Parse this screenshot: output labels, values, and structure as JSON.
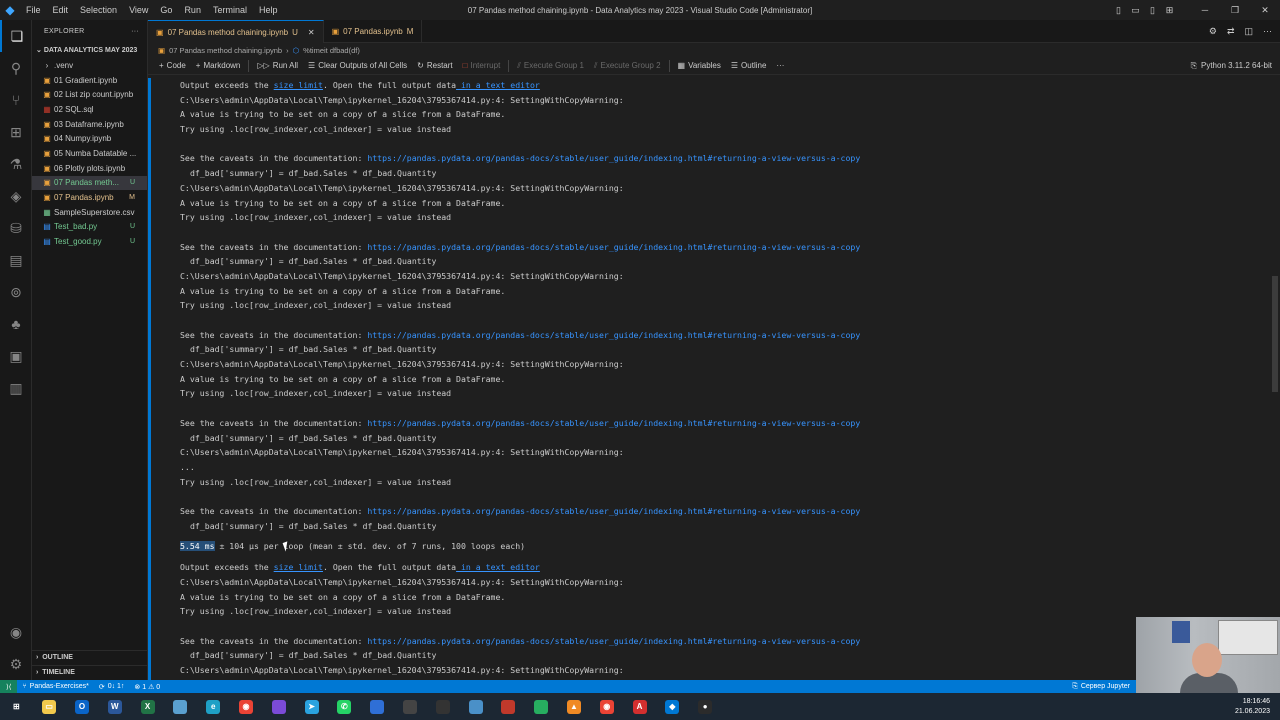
{
  "titlebar": {
    "menu": [
      "File",
      "Edit",
      "Selection",
      "View",
      "Go",
      "Run",
      "Terminal",
      "Help"
    ],
    "window_title": "07 Pandas method chaining.ipynb - Data Analytics may 2023 - Visual Studio Code [Administrator]"
  },
  "sidebar": {
    "header": "EXPLORER",
    "folder": "DATA ANALYTICS MAY 2023",
    "files": [
      {
        "name": ".venv",
        "status": "",
        "kind": "folder"
      },
      {
        "name": "01 Gradient.ipynb",
        "status": "",
        "kind": "nb"
      },
      {
        "name": "02 List zip count.ipynb",
        "status": "",
        "kind": "nb"
      },
      {
        "name": "02 SQL.sql",
        "status": "",
        "kind": "sql"
      },
      {
        "name": "03 Dataframe.ipynb",
        "status": "",
        "kind": "nb"
      },
      {
        "name": "04 Numpy.ipynb",
        "status": "",
        "kind": "nb"
      },
      {
        "name": "05 Numba Datatable ...",
        "status": "",
        "kind": "nb"
      },
      {
        "name": "06 Plotly plots.ipynb",
        "status": "",
        "kind": "nb"
      },
      {
        "name": "07 Pandas meth...",
        "status": "U",
        "kind": "nb"
      },
      {
        "name": "07 Pandas.ipynb",
        "status": "M",
        "kind": "nb"
      },
      {
        "name": "SampleSuperstore.csv",
        "status": "",
        "kind": "csv"
      },
      {
        "name": "Test_bad.py",
        "status": "U",
        "kind": "py"
      },
      {
        "name": "Test_good.py",
        "status": "U",
        "kind": "py"
      }
    ],
    "outline": "OUTLINE",
    "timeline": "TIMELINE"
  },
  "tabs": [
    {
      "label": "07 Pandas method chaining.ipynb",
      "status": "U"
    },
    {
      "label": "07 Pandas.ipynb",
      "status": "M"
    }
  ],
  "breadcrumb": {
    "file": "07 Pandas method chaining.ipynb",
    "cell": "%timeit dfbad(df)"
  },
  "toolbar": {
    "code": "Code",
    "markdown": "Markdown",
    "run_all": "Run All",
    "clear": "Clear Outputs of All Cells",
    "restart": "Restart",
    "interrupt": "Interrupt",
    "group1": "Execute Group 1",
    "group2": "Execute Group 2",
    "variables": "Variables",
    "outline": "Outline",
    "kernel": "Python 3.11.2 64-bit"
  },
  "output": {
    "exceeds_pre": "Output exceeds the ",
    "size_limit": "size limit",
    "exceeds_mid": ". Open the full output data",
    "text_editor": " in a text editor",
    "warn_path": "C:\\Users\\admin\\AppData\\Local\\Temp\\ipykernel_16204\\3795367414.py:4: SettingWithCopyWarning:",
    "warn_value": "A value is trying to be set on a copy of a slice from a DataFrame.",
    "warn_try": "Try using .loc[row_indexer,col_indexer] = value instead",
    "caveats": "See the caveats in the documentation: ",
    "doc_url": "https://pandas.pydata.org/pandas-docs/stable/user_guide/indexing.html#returning-a-view-versus-a-copy",
    "code_line": "df_bad['summary'] = df_bad.Sales * df_bad.Quantity",
    "ellipsis": "...",
    "timing_sel": "5.54 ms",
    "timing_rest": " ± 104 µs per loop (mean ± std. dev. of 7 runs, 100 loops each)"
  },
  "statusbar": {
    "remote": "Pandas-Exercises*",
    "sync": "0↓ 1↑",
    "problems": "⊗ 1 ⚠ 0",
    "jupyter": "Сервер Jupyter"
  },
  "taskbar": {
    "time": "18:16:46",
    "date": "21.06.2023",
    "apps": [
      {
        "name": "windows-start",
        "color": "#ffffff"
      },
      {
        "name": "file-explorer",
        "color": "#f2c94c"
      },
      {
        "name": "outlook",
        "color": "#0a64c8"
      },
      {
        "name": "word",
        "color": "#2b579a"
      },
      {
        "name": "excel",
        "color": "#217346"
      },
      {
        "name": "notepad",
        "color": "#5aa0d0"
      },
      {
        "name": "edge",
        "color": "#1fa0c6"
      },
      {
        "name": "chrome",
        "color": "#ea4335"
      },
      {
        "name": "app-purple",
        "color": "#7b4bd8"
      },
      {
        "name": "telegram",
        "color": "#2aa3e0"
      },
      {
        "name": "whatsapp",
        "color": "#25d366"
      },
      {
        "name": "app-blue",
        "color": "#2f6fd6"
      },
      {
        "name": "app-dark",
        "color": "#444444"
      },
      {
        "name": "app-terminal",
        "color": "#333333"
      },
      {
        "name": "app-doc",
        "color": "#4a90c8"
      },
      {
        "name": "app-red",
        "color": "#c0392b"
      },
      {
        "name": "app-green",
        "color": "#27ae60"
      },
      {
        "name": "vlc",
        "color": "#f08a24"
      },
      {
        "name": "chrome-2",
        "color": "#ea4335"
      },
      {
        "name": "acrobat",
        "color": "#d32f2f"
      },
      {
        "name": "vscode",
        "color": "#0078d4"
      },
      {
        "name": "obs",
        "color": "#2b2b2b"
      }
    ]
  }
}
